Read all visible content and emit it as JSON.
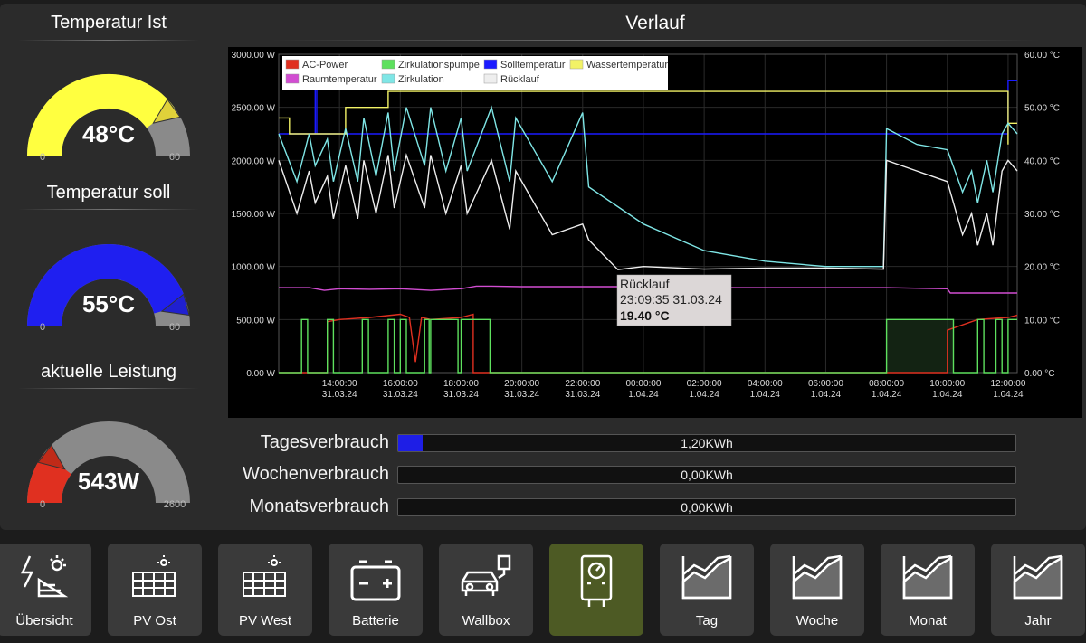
{
  "gauges": [
    {
      "title": "Temperatur Ist",
      "value_text": "48°C",
      "min_label": "0",
      "max_label": "60",
      "value": 48,
      "max": 60,
      "color": "#ffff40",
      "bg": "#8a8a8a",
      "indicator": "#e0d13a"
    },
    {
      "title": "Temperatur soll",
      "value_text": "55°C",
      "min_label": "0",
      "max_label": "60",
      "value": 55,
      "max": 60,
      "color": "#1f1ff0",
      "bg": "#8a8a8a",
      "indicator": "#2020d0"
    },
    {
      "title": "aktuelle Leistung",
      "value_text": "543W",
      "min_label": "0",
      "max_label": "2600",
      "value": 543,
      "max": 2600,
      "color": "#e03020",
      "bg": "#8a8a8a",
      "indicator": "#c02a18"
    }
  ],
  "verlauf_title": "Verlauf",
  "chart_data": {
    "type": "line",
    "y_left_ticks": [
      "3000.00 W",
      "2500.00 W",
      "2000.00 W",
      "1500.00 W",
      "1000.00 W",
      "500.00 W",
      "0.00 W"
    ],
    "y_right_ticks": [
      "60.00 °C",
      "50.00 °C",
      "40.00 °C",
      "30.00 °C",
      "20.00 °C",
      "10.00 °C",
      "0.00 °C"
    ],
    "y_left_range": [
      0,
      3000
    ],
    "y_right_range": [
      0,
      60
    ],
    "x_ticks": [
      {
        "time": "14:00:00",
        "date": "31.03.24"
      },
      {
        "time": "16:00:00",
        "date": "31.03.24"
      },
      {
        "time": "18:00:00",
        "date": "31.03.24"
      },
      {
        "time": "20:00:00",
        "date": "31.03.24"
      },
      {
        "time": "22:00:00",
        "date": "31.03.24"
      },
      {
        "time": "00:00:00",
        "date": "1.04.24"
      },
      {
        "time": "02:00:00",
        "date": "1.04.24"
      },
      {
        "time": "04:00:00",
        "date": "1.04.24"
      },
      {
        "time": "06:00:00",
        "date": "1.04.24"
      },
      {
        "time": "08:00:00",
        "date": "1.04.24"
      },
      {
        "time": "10:00:00",
        "date": "1.04.24"
      },
      {
        "time": "12:00:00",
        "date": "1.04.24"
      }
    ],
    "x_range_hours": [
      12.0,
      36.3
    ],
    "legend": [
      {
        "name": "AC-Power",
        "color": "#e03020"
      },
      {
        "name": "Zirkulationspumpe",
        "color": "#5ee05e"
      },
      {
        "name": "Solltemperatur",
        "color": "#1a1aff"
      },
      {
        "name": "Wassertemperatur",
        "color": "#f2f266"
      },
      {
        "name": "Raumtemperatur",
        "color": "#d24dd2"
      },
      {
        "name": "Zirkulation",
        "color": "#7fe6e6"
      },
      {
        "name": "Rücklauf",
        "color": "#eeeeee"
      }
    ],
    "series": [
      {
        "name": "Solltemperatur",
        "axis": "right",
        "color": "#1a1aff",
        "x": [
          12.0,
          13.2,
          13.2,
          13.25,
          13.25,
          18.9,
          18.9,
          36.0,
          36.0,
          36.3
        ],
        "y": [
          45,
          45,
          55,
          55,
          45,
          45,
          45,
          45,
          55,
          55
        ]
      },
      {
        "name": "Wassertemperatur",
        "axis": "right",
        "color": "#f2f266",
        "x": [
          12.0,
          12.35,
          12.35,
          14.2,
          14.2,
          15.6,
          15.6,
          36.0,
          36.0,
          36.0,
          36.3
        ],
        "y": [
          48,
          48,
          45,
          45,
          50,
          50,
          53,
          53,
          43,
          47,
          47
        ]
      },
      {
        "name": "Raumtemperatur",
        "axis": "right",
        "color": "#d24dd2",
        "x": [
          12.0,
          13.0,
          13.5,
          14.0,
          15.0,
          16.0,
          17.0,
          18.0,
          18.5,
          19.0,
          20.0,
          22.0,
          24.0,
          26.0,
          28.0,
          30.0,
          32.0,
          34.0,
          34.1,
          36.0,
          36.3
        ],
        "y": [
          16,
          16,
          15.5,
          15.8,
          15.7,
          15.8,
          15.5,
          15.8,
          16.3,
          16.3,
          16.2,
          16.2,
          16.2,
          16.0,
          16.0,
          16.0,
          16.0,
          15.8,
          15.0,
          15.0,
          15.0
        ]
      },
      {
        "name": "Zirkulation",
        "axis": "right",
        "color": "#7fe6e6",
        "x": [
          12.0,
          12.6,
          13.0,
          13.2,
          13.6,
          13.8,
          14.2,
          14.6,
          14.8,
          15.2,
          15.6,
          15.8,
          16.2,
          16.8,
          17.0,
          17.5,
          18.0,
          18.2,
          19.0,
          19.6,
          19.8,
          21.0,
          22.0,
          22.2,
          24.0,
          26.0,
          28.0,
          30.0,
          31.9,
          32.0,
          33.0,
          34.0,
          34.5,
          34.8,
          35.0,
          35.3,
          35.5,
          35.8,
          36.0,
          36.3
        ],
        "y": [
          45,
          36,
          45,
          39,
          44,
          36,
          46,
          36,
          48,
          37,
          49,
          38,
          50,
          39,
          50,
          38,
          48,
          38,
          50,
          36,
          48,
          36,
          49,
          35,
          28,
          23,
          21,
          20,
          20,
          46,
          43,
          42,
          34,
          38,
          32,
          40,
          34,
          45,
          47,
          45
        ]
      },
      {
        "name": "Rücklauf",
        "axis": "right",
        "color": "#eeeeee",
        "x": [
          12.0,
          12.6,
          13.0,
          13.2,
          13.6,
          13.8,
          14.2,
          14.6,
          14.8,
          15.2,
          15.6,
          15.8,
          16.2,
          16.8,
          17.0,
          17.5,
          18.0,
          18.2,
          19.0,
          19.6,
          19.8,
          21.0,
          22.0,
          22.2,
          23.16,
          24.0,
          26.0,
          28.0,
          30.0,
          31.9,
          32.0,
          33.0,
          34.0,
          34.5,
          34.8,
          35.0,
          35.3,
          35.5,
          35.8,
          36.0,
          36.3
        ],
        "y": [
          40,
          30,
          38,
          32,
          37,
          29,
          39,
          29,
          40,
          30,
          41,
          31,
          41,
          31,
          41,
          30,
          39,
          30,
          40,
          27,
          38,
          26,
          28,
          25,
          19.4,
          20,
          19.5,
          19.7,
          19.7,
          19.5,
          40,
          38,
          36,
          26,
          30,
          24,
          30,
          24,
          38,
          40,
          38
        ]
      },
      {
        "name": "AC-Power",
        "axis": "left",
        "color": "#e03020",
        "x": [
          12.0,
          13.6,
          13.6,
          14.0,
          15.0,
          16.0,
          16.3,
          16.5,
          16.7,
          17.0,
          18.0,
          18.4,
          18.4,
          34.0,
          34.0,
          35.0,
          36.0,
          36.3
        ],
        "y": [
          0,
          0,
          480,
          500,
          520,
          550,
          520,
          100,
          520,
          500,
          520,
          550,
          0,
          0,
          400,
          500,
          520,
          540
        ]
      },
      {
        "name": "Zirkulationspumpe",
        "axis": "left",
        "color": "#5ee05e",
        "x": [
          12.0,
          12.75,
          12.75,
          12.95,
          12.95,
          13.6,
          13.6,
          13.8,
          13.8,
          14.75,
          14.75,
          14.95,
          14.95,
          15.6,
          15.6,
          15.8,
          15.8,
          16.0,
          16.0,
          16.2,
          16.2,
          16.8,
          16.8,
          16.95,
          16.95,
          17.0,
          17.0,
          17.9,
          17.9,
          18.0,
          18.0,
          18.95,
          18.95,
          19.15,
          19.15,
          32.0,
          32.0,
          34.2,
          34.2,
          35.0,
          35.0,
          35.2,
          35.2,
          35.6,
          35.6,
          35.8,
          35.8,
          36.0,
          36.0,
          36.3
        ],
        "y": [
          0,
          0,
          500,
          500,
          0,
          0,
          500,
          500,
          0,
          0,
          500,
          500,
          0,
          0,
          500,
          500,
          0,
          0,
          500,
          500,
          0,
          0,
          500,
          500,
          0,
          0,
          500,
          500,
          0,
          0,
          500,
          500,
          0,
          0,
          0,
          0,
          500,
          500,
          0,
          0,
          500,
          500,
          0,
          0,
          500,
          500,
          0,
          0,
          500,
          500
        ]
      }
    ],
    "tooltip": {
      "title": "Rücklauf",
      "timestamp": "23:09:35 31.03.24",
      "value": "19.40 °C"
    }
  },
  "consumption": [
    {
      "label": "Tagesverbrauch",
      "value_text": "1,20KWh",
      "fill_fraction": 0.04
    },
    {
      "label": "Wochenverbrauch",
      "value_text": "0,00KWh",
      "fill_fraction": 0
    },
    {
      "label": "Monatsverbrauch",
      "value_text": "0,00KWh",
      "fill_fraction": 0
    }
  ],
  "nav": [
    {
      "label": "Übersicht",
      "icon": "solar-panel-sun-icon",
      "active": false
    },
    {
      "label": "PV Ost",
      "icon": "solar-panel-icon",
      "active": false
    },
    {
      "label": "PV West",
      "icon": "solar-panel-icon",
      "active": false
    },
    {
      "label": "Batterie",
      "icon": "battery-icon",
      "active": false
    },
    {
      "label": "Wallbox",
      "icon": "car-charger-icon",
      "active": false
    },
    {
      "label": "",
      "icon": "water-heater-icon",
      "active": true
    },
    {
      "label": "Tag",
      "icon": "area-chart-icon",
      "active": false
    },
    {
      "label": "Woche",
      "icon": "area-chart-icon",
      "active": false
    },
    {
      "label": "Monat",
      "icon": "area-chart-icon",
      "active": false
    },
    {
      "label": "Jahr",
      "icon": "area-chart-icon",
      "active": false
    }
  ]
}
